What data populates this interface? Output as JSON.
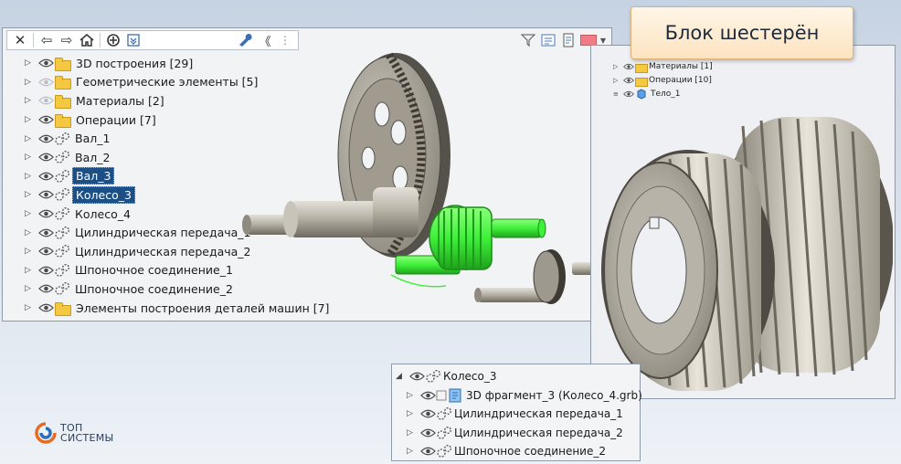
{
  "title": "Блок шестерён",
  "main_panel": {
    "toolbar": {
      "close": "✕",
      "back": "⇦",
      "forward": "⇨",
      "home": "⌂",
      "collapse": "《"
    },
    "tree": [
      {
        "label": "3D построения [29]",
        "type": "folder",
        "visible": true
      },
      {
        "label": "Геометрические элементы [5]",
        "type": "folder",
        "visible": false
      },
      {
        "label": "Материалы [2]",
        "type": "folder",
        "visible": false
      },
      {
        "label": "Операции [7]",
        "type": "folder",
        "visible": true
      },
      {
        "label": "Вал_1",
        "type": "part",
        "visible": true
      },
      {
        "label": "Вал_2",
        "type": "part",
        "visible": true
      },
      {
        "label": "Вал_3",
        "type": "part",
        "visible": true,
        "selected": true
      },
      {
        "label": "Колесо_3",
        "type": "part",
        "visible": true,
        "selected": true
      },
      {
        "label": "Колесо_4",
        "type": "part",
        "visible": true
      },
      {
        "label": "Цилиндрическая передача_1",
        "type": "part",
        "visible": true
      },
      {
        "label": "Цилиндрическая передача_2",
        "type": "part",
        "visible": true
      },
      {
        "label": "Шпоночное соединение_1",
        "type": "part",
        "visible": true
      },
      {
        "label": "Шпоночное соединение_2",
        "type": "part",
        "visible": true
      },
      {
        "label": "Элементы построения деталей машин [7]",
        "type": "folder",
        "visible": true
      }
    ]
  },
  "right_panel": {
    "tree": [
      {
        "label": "Материалы [1]",
        "type": "folder"
      },
      {
        "label": "Операции [10]",
        "type": "folder"
      },
      {
        "label": "Тело_1",
        "type": "body"
      }
    ]
  },
  "small_panel": {
    "tree": [
      {
        "label": "Колесо_3",
        "expanded": true
      },
      {
        "label": "3D фрагмент_3 (Колесо_4.grb)"
      },
      {
        "label": "Цилиндрическая передача_1"
      },
      {
        "label": "Цилиндрическая передача_2"
      },
      {
        "label": "Шпоночное соединение_2"
      }
    ]
  },
  "logo": {
    "line1": "ТОП",
    "line2": "СИСТЕМЫ"
  },
  "colors": {
    "selection": "#1c4f86",
    "highlight_green": "#3ef03a",
    "title_bg": "#fde3c0",
    "folder": "#f5c842"
  }
}
